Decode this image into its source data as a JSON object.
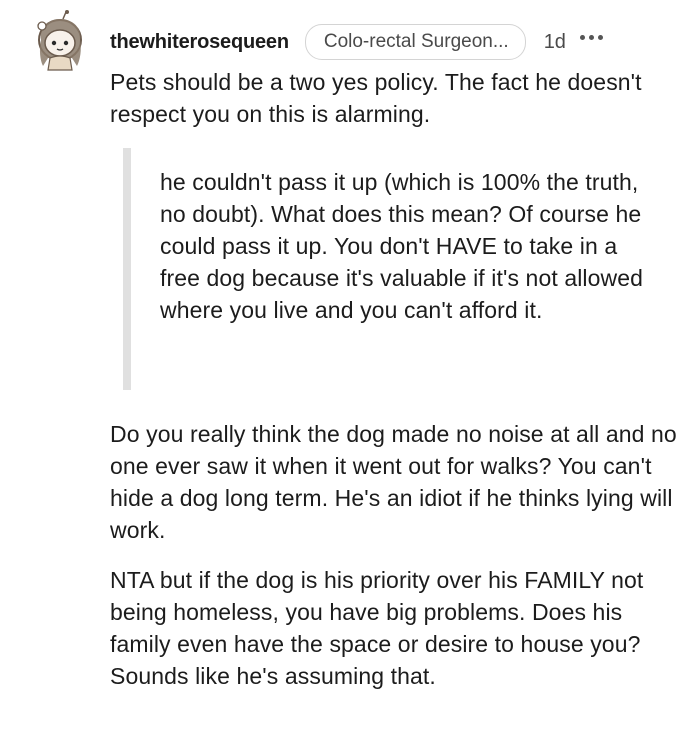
{
  "comment": {
    "username": "thewhiterosequeen",
    "flair": "Colo-rectal Surgeon...",
    "time": "1d",
    "paragraph_1": "Pets should be a two yes policy. The fact he doesn't respect you on this is alarming.",
    "quote": "he couldn't pass it up (which is 100% the truth, no doubt). What does this mean? Of course he could pass it up. You don't HAVE to take in a free dog because it's valuable if it's not allowed where you live and you can't afford it.",
    "paragraph_2": "Do you really think the dog made no noise at all and no one ever saw it when it went out for walks? You can't hide a dog long term. He's an idiot if he thinks lying will work.",
    "paragraph_3": "NTA but if the dog is his priority over his FAMILY not being homeless, you have big problems. Does his family even have the space or desire to house you? Sounds like he's assuming that."
  },
  "icons": {
    "avatar": "snoo-avatar",
    "more": "more-options-icon"
  },
  "colors": {
    "text": "#1c1c1c",
    "meta": "#4a4a4a",
    "quote_bar": "#e0e0e0",
    "flair_border": "#d4d4d4",
    "avatar_hair": "#8a7a6a",
    "avatar_skin": "#f3e6d6"
  }
}
